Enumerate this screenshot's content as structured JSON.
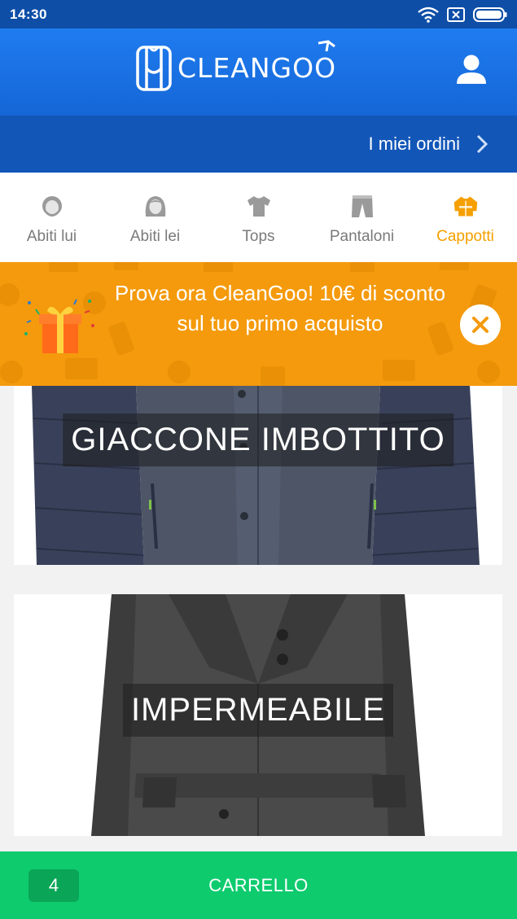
{
  "status_bar": {
    "time": "14:30"
  },
  "header": {
    "logo_text": "CLEANGOO"
  },
  "orders": {
    "label": "I miei ordini"
  },
  "categories": [
    {
      "label": "Abiti lui",
      "icon": "man-face-icon",
      "active": false
    },
    {
      "label": "Abiti lei",
      "icon": "woman-face-icon",
      "active": false
    },
    {
      "label": "Tops",
      "icon": "tshirt-icon",
      "active": false
    },
    {
      "label": "Pantaloni",
      "icon": "trousers-icon",
      "active": false
    },
    {
      "label": "Cappotti",
      "icon": "coat-icon",
      "active": true
    }
  ],
  "promo": {
    "text": "Prova ora CleanGoo! 10€ di sconto sul tuo primo acquisto"
  },
  "products": [
    {
      "label": "GIACCONE IMBOTTITO"
    },
    {
      "label": "IMPERMEABILE"
    }
  ],
  "cart": {
    "count": "4",
    "label": "CARRELLO"
  },
  "colors": {
    "primary": "#1f7cf0",
    "accent": "#f5a000",
    "promo": "#f49a0c",
    "cart": "#0ecb6e"
  }
}
